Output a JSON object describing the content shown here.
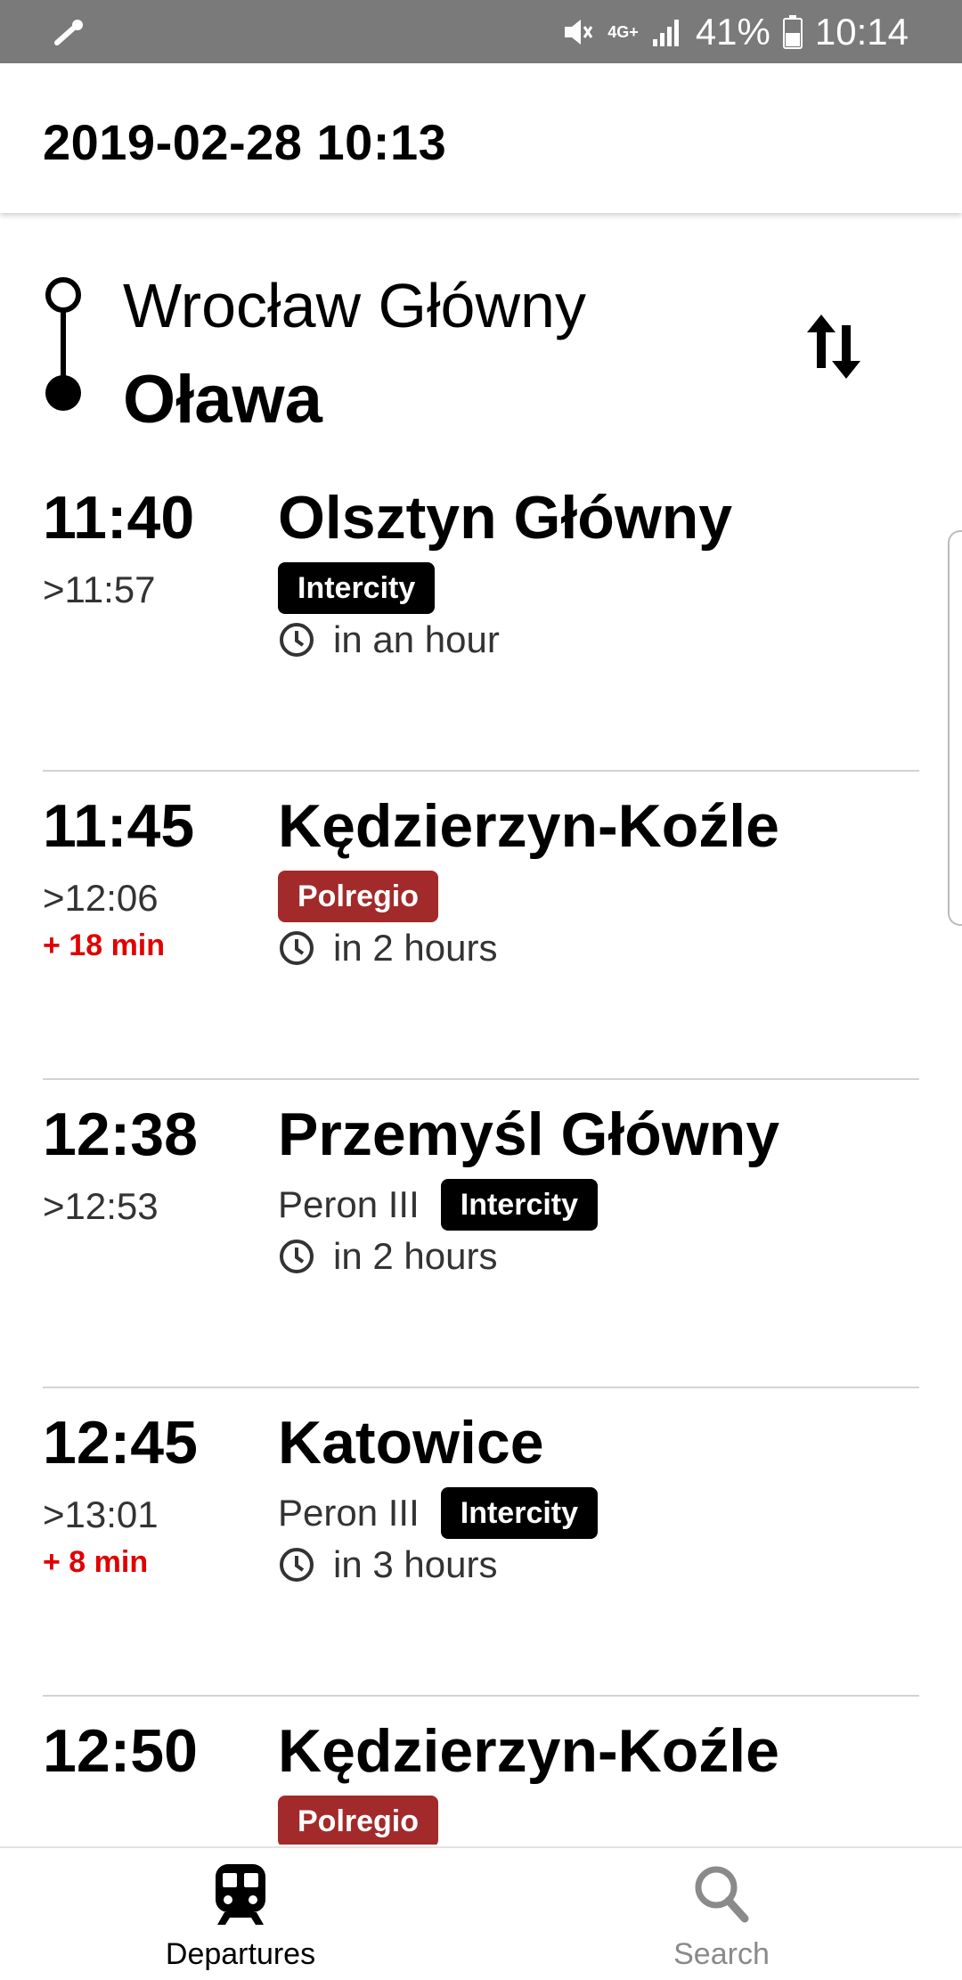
{
  "status_bar": {
    "network": "4G+",
    "battery": "41%",
    "time": "10:14",
    "icons": [
      "wrench-icon",
      "mute-icon",
      "signal-icon",
      "battery-icon"
    ]
  },
  "header": {
    "datetime": "2019-02-28 10:13"
  },
  "route": {
    "from": "Wrocław Główny",
    "to": "Oława"
  },
  "colors": {
    "intercity": "#000000",
    "polregio": "#a32a2a",
    "delay": "#e00000"
  },
  "departures": [
    {
      "time": "11:40",
      "arrival": ">11:57",
      "delay": "",
      "destination": "Olsztyn Główny",
      "platform": "",
      "carrier": "Intercity",
      "eta": "in an hour"
    },
    {
      "time": "11:45",
      "arrival": ">12:06",
      "delay": "+ 18 min",
      "destination": "Kędzierzyn-Koźle",
      "platform": "",
      "carrier": "Polregio",
      "eta": "in 2 hours"
    },
    {
      "time": "12:38",
      "arrival": ">12:53",
      "delay": "",
      "destination": "Przemyśl Główny",
      "platform": "Peron III",
      "carrier": "Intercity",
      "eta": "in 2 hours"
    },
    {
      "time": "12:45",
      "arrival": ">13:01",
      "delay": "+ 8 min",
      "destination": "Katowice",
      "platform": "Peron III",
      "carrier": "Intercity",
      "eta": "in 3 hours"
    },
    {
      "time": "12:50",
      "arrival": "",
      "delay": "",
      "destination": "Kędzierzyn-Koźle",
      "platform": "",
      "carrier": "Polregio",
      "eta": ""
    }
  ],
  "nav": {
    "departures": "Departures",
    "search": "Search"
  }
}
